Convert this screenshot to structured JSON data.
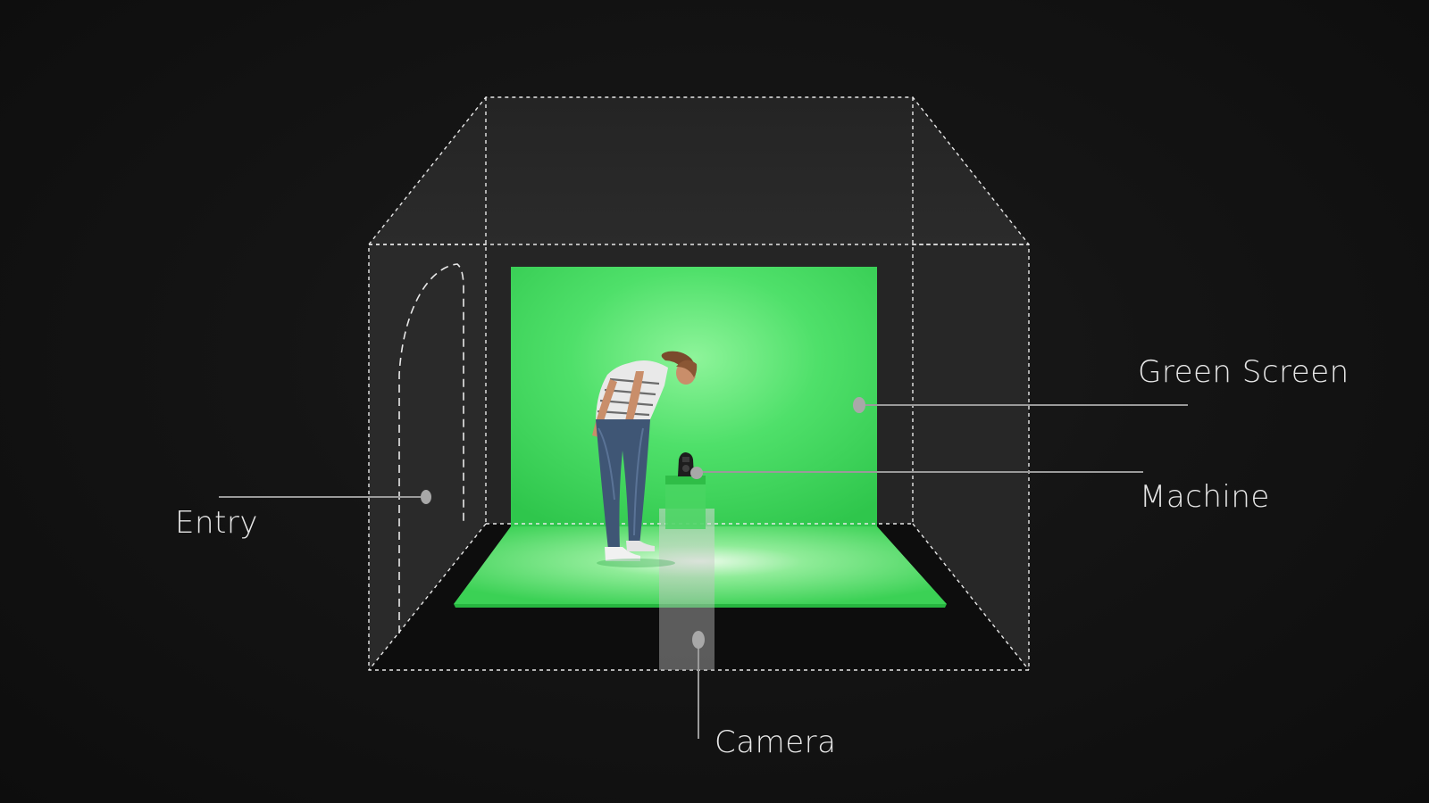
{
  "labels": {
    "green_screen": "Green Screen",
    "machine": "Machine",
    "entry": "Entry",
    "camera": "Camera"
  },
  "colors": {
    "background": "#111111",
    "room_wall": "#262626",
    "dashed_edge": "#e8e8e8",
    "chroma_green": "#3ddc5a",
    "callout_line": "#9a9a9a",
    "label_text": "#e6e6e6"
  },
  "icons": {
    "person": "woman-looking-down-figure",
    "machine": "camera-machine-figure",
    "callout_marker": "pin-dot"
  }
}
